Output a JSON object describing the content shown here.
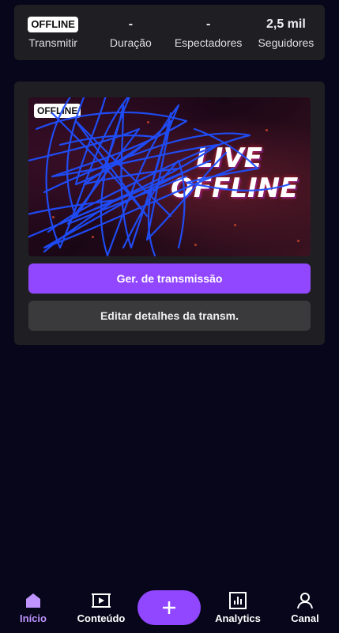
{
  "stats": {
    "status_badge": "OFFLINE",
    "status_label": "Transmitir",
    "duration_value": "-",
    "duration_label": "Duração",
    "viewers_value": "-",
    "viewers_label": "Espectadores",
    "followers_value": "2,5 mil",
    "followers_label": "Seguidores"
  },
  "stream_card": {
    "thumbnail_badge": "OFFLINE",
    "thumbnail_text_line1": "LIVE",
    "thumbnail_text_line2": "OFFLINE",
    "manage_button": "Ger. de transmissão",
    "edit_button": "Editar detalhes da transm."
  },
  "bottom_nav": {
    "items": [
      {
        "label": "Início",
        "icon": "home-icon",
        "active": true
      },
      {
        "label": "Conteúdo",
        "icon": "content-icon",
        "active": false
      },
      {
        "label": "+",
        "icon": "plus-icon",
        "active": false
      },
      {
        "label": "Analytics",
        "icon": "analytics-icon",
        "active": false
      },
      {
        "label": "Canal",
        "icon": "user-icon",
        "active": false
      }
    ]
  },
  "colors": {
    "background": "#07061a",
    "card": "#1f1f23",
    "accent": "#9147ff",
    "active_nav": "#bf94ff",
    "secondary_button": "#3a3a3d"
  }
}
